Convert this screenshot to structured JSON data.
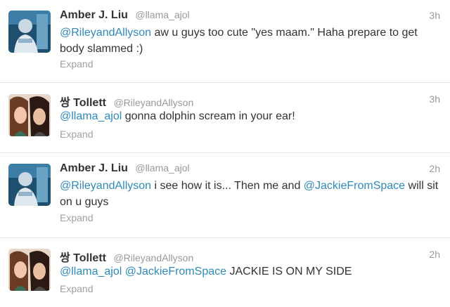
{
  "tweets": [
    {
      "fullname": "Amber J. Liu",
      "screen_name": "@llama_ajol",
      "time": "3h",
      "avatar_icon": "profile-photo-amber",
      "mention1": "@RileyandAllyson",
      "text1": " aw u guys too cute \"yes maam.\" Haha prepare to get body slammed :)",
      "expand": "Expand"
    },
    {
      "fullname": "쌍 Tollett",
      "screen_name": "@RileyandAllyson",
      "time": "3h",
      "avatar_icon": "profile-photo-tollett",
      "mention1": "@llama_ajol",
      "text1": " gonna dolphin scream in your ear!",
      "expand": "Expand"
    },
    {
      "fullname": "Amber J. Liu",
      "screen_name": "@llama_ajol",
      "time": "2h",
      "avatar_icon": "profile-photo-amber",
      "mention1": "@RileyandAllyson",
      "text1": " i see how it is... Then me and ",
      "mention2": "@JackieFromSpace",
      "text2": " will sit on u guys",
      "expand": "Expand"
    },
    {
      "fullname": "쌍 Tollett",
      "screen_name": "@RileyandAllyson",
      "time": "2h",
      "avatar_icon": "profile-photo-tollett",
      "mention1": "@llama_ajol",
      "text1": " ",
      "mention2": "@JackieFromSpace",
      "text2": " JACKIE IS ON MY SIDE",
      "expand": "Expand"
    }
  ],
  "colors": {
    "mention": "#2f8ab8",
    "muted": "#999999",
    "text": "#333333",
    "divider": "#e3e3e3"
  }
}
